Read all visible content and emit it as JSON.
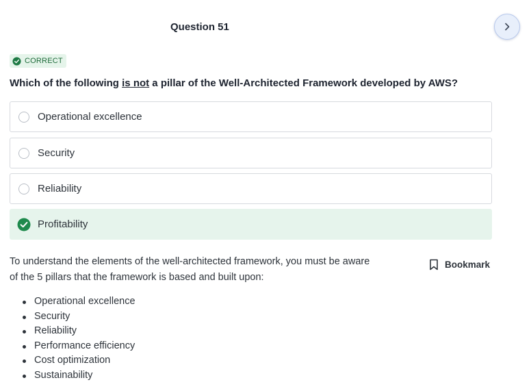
{
  "question": {
    "title": "Question 51",
    "status": "CORRECT",
    "text_before": "Which of the following ",
    "text_emphasis": "is not",
    "text_after": " a pillar of the Well-Architected Framework developed by AWS?"
  },
  "options": [
    {
      "label": "Operational excellence",
      "selected": false
    },
    {
      "label": "Security",
      "selected": false
    },
    {
      "label": "Reliability",
      "selected": false
    },
    {
      "label": "Profitability",
      "selected": true
    }
  ],
  "explanation": {
    "text": "To understand the elements of the well-architected framework, you must be aware of the 5 pillars that the framework is based and built upon:",
    "pillars": [
      "Operational excellence",
      "Security",
      "Reliability",
      "Performance efficiency",
      "Cost optimization",
      "Sustainability"
    ]
  },
  "actions": {
    "bookmark_label": "Bookmark",
    "next_icon": "chevron-right-icon"
  },
  "colors": {
    "correct_green": "#1e8a4c",
    "correct_bg": "#e6f4ec",
    "next_bg": "#e8effb"
  }
}
